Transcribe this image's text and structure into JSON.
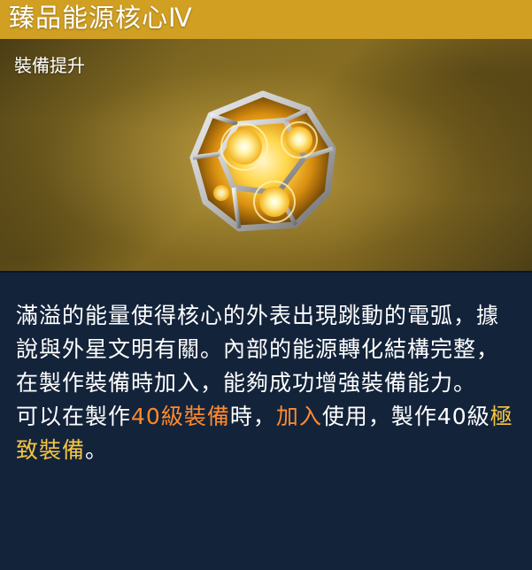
{
  "item": {
    "title": "臻品能源核心Ⅳ",
    "subtitle": "裝備提升",
    "icon": "energy-core-icon",
    "colors": {
      "title_bar": "#d1a023",
      "panel_background": "#13233a",
      "highlight_orange": "#ff8a2e",
      "highlight_gold": "#f5c542"
    }
  },
  "description": {
    "paragraph1": "滿溢的能量使得核心的外表出現跳動的電弧，據說與外星文明有關。內部的能源轉化結構完整，在製作裝備時加入，能夠成功增強裝備能力。",
    "line2_part1": "可以在製作",
    "line2_hl1": "40級裝備",
    "line2_part2": "時，",
    "line2_hl2": "加入",
    "line2_part3": "使用，製作40級",
    "line2_hl3": "極致裝備",
    "line2_part4": "。"
  }
}
